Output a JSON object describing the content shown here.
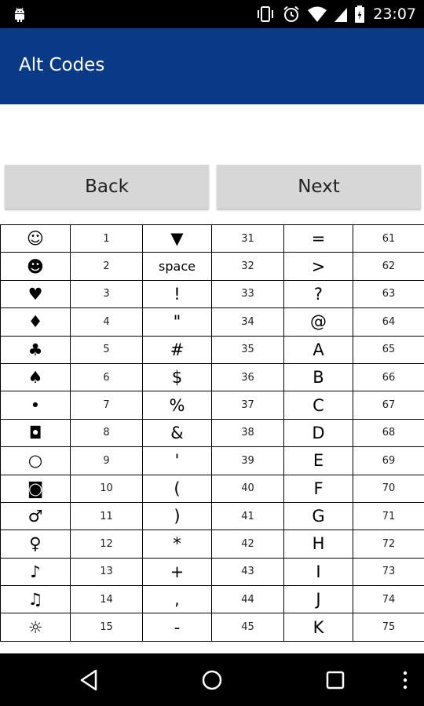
{
  "status_bar": {
    "time": "23:07"
  },
  "app_bar": {
    "title": "Alt Codes"
  },
  "buttons": {
    "back": "Back",
    "next": "Next"
  },
  "table": {
    "rows": [
      [
        "☺",
        "1",
        "▼",
        "31",
        "=",
        "61"
      ],
      [
        "☻",
        "2",
        "space",
        "32",
        ">",
        "62"
      ],
      [
        "♥",
        "3",
        "!",
        "33",
        "?",
        "63"
      ],
      [
        "♦",
        "4",
        "\"",
        "34",
        "@",
        "64"
      ],
      [
        "♣",
        "5",
        "#",
        "35",
        "A",
        "65"
      ],
      [
        "♠",
        "6",
        "$",
        "36",
        "B",
        "66"
      ],
      [
        "•",
        "7",
        "%",
        "37",
        "C",
        "67"
      ],
      [
        "◘",
        "8",
        "&",
        "38",
        "D",
        "68"
      ],
      [
        "○",
        "9",
        "'",
        "39",
        "E",
        "69"
      ],
      [
        "◙",
        "10",
        "(",
        "40",
        "F",
        "70"
      ],
      [
        "♂",
        "11",
        ")",
        "41",
        "G",
        "71"
      ],
      [
        "♀",
        "12",
        "*",
        "42",
        "H",
        "72"
      ],
      [
        "♪",
        "13",
        "+",
        "43",
        "I",
        "73"
      ],
      [
        "♫",
        "14",
        ",",
        "44",
        "J",
        "74"
      ],
      [
        "☼",
        "15",
        "-",
        "45",
        "K",
        "75"
      ]
    ]
  },
  "colors": {
    "app_bar": "#0a3a86",
    "button_bg": "#d7d7d7",
    "system_bars": "#000000"
  },
  "icons": {
    "status": [
      "android-icon",
      "vibrate-icon",
      "alarm-icon",
      "wifi-icon",
      "cellular-signal-icon",
      "battery-icon"
    ],
    "nav": [
      "nav-back-icon",
      "nav-home-icon",
      "nav-recents-icon",
      "overflow-menu-icon"
    ]
  }
}
